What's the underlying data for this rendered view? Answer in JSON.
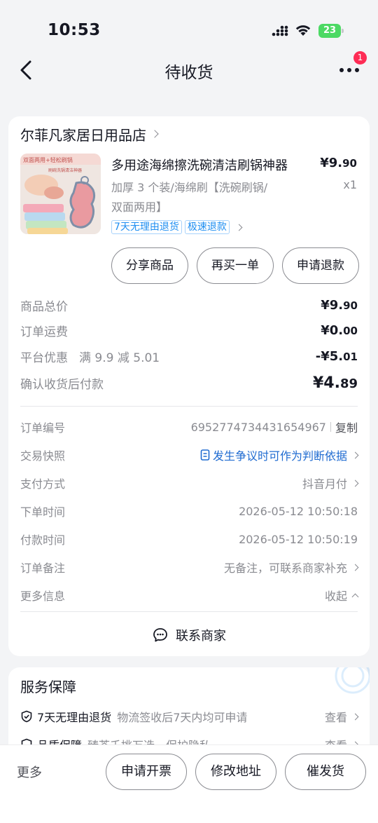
{
  "status_bar": {
    "time": "10:53",
    "battery": "23"
  },
  "nav": {
    "title": "待收货",
    "badge": "1"
  },
  "shop": {
    "name": "尔菲凡家居日用品店"
  },
  "product": {
    "title": "多用途海绵擦洗碗清洁刷锅神器",
    "price_int": "¥9.",
    "price_dec": "90",
    "spec_line1": "加厚 3 个装/海绵刷【洗碗刷锅/",
    "spec_line2": "双面两用】",
    "qty": "x1",
    "tags": [
      "7天无理由退货",
      "极速退款"
    ],
    "thumb_caption_1": "双面两用+轻松刷锅",
    "thumb_caption_2": "刷碗洗锅清洁神器"
  },
  "actions": {
    "share": "分享商品",
    "rebuy": "再买一单",
    "refund": "申请退款"
  },
  "summary": {
    "total_label": "商品总价",
    "total_int": "¥9.",
    "total_dec": "90",
    "shipping_label": "订单运费",
    "shipping_int": "¥0.",
    "shipping_dec": "00",
    "discount_label": "平台优惠",
    "discount_note": "满 9.9 减 5.01",
    "discount_int": "-¥5.",
    "discount_dec": "01",
    "pay_label": "确认收货后付款",
    "pay_int": "¥4.",
    "pay_dec": "89"
  },
  "details": {
    "order_no_label": "订单编号",
    "order_no": "6952774734431654967",
    "copy": "复制",
    "snapshot_label": "交易快照",
    "snapshot_value": "发生争议时可作为判断依据",
    "payment_label": "支付方式",
    "payment_value": "抖音月付",
    "order_time_label": "下单时间",
    "order_time": "2026-05-12 10:50:18",
    "pay_time_label": "付款时间",
    "pay_time": "2026-05-12 10:50:19",
    "note_label": "订单备注",
    "note_value": "无备注，可联系商家补充",
    "more_label": "更多信息",
    "collapse": "收起"
  },
  "contact": {
    "label": "联系商家"
  },
  "service": {
    "title": "服务保障",
    "row1_name": "7天无理由退货",
    "row1_desc": "物流签收后7天内均可申请",
    "row1_action": "查看",
    "row2_name": "品质保障",
    "row2_desc": "臻荟千挑万选，保护隐私",
    "row2_action": "查看"
  },
  "bottom": {
    "more": "更多",
    "invoice": "申请开票",
    "address": "修改地址",
    "urge": "催发货"
  },
  "colors": {
    "link_blue": "#1f6bd1",
    "tag_blue": "#1f8ef1",
    "badge_red": "#fe2c55",
    "battery_green": "#4cd964"
  }
}
